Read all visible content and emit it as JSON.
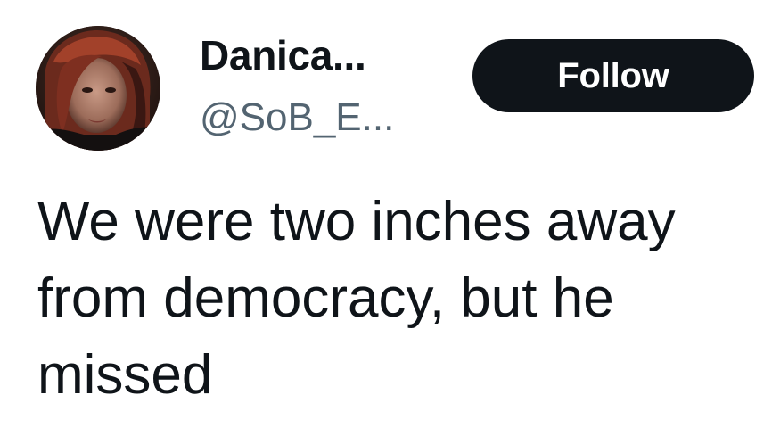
{
  "author": {
    "display_name": "Danica...",
    "handle": "@SoB_E..."
  },
  "follow_button": {
    "label": "Follow"
  },
  "tweet": {
    "text": "We were two inches away from democracy, but he missed"
  },
  "colors": {
    "text_primary": "#0f1419",
    "text_secondary": "#536471",
    "button_bg": "#0f1419",
    "button_text": "#ffffff",
    "background": "#ffffff"
  },
  "icons": {
    "avatar": "profile-photo"
  }
}
